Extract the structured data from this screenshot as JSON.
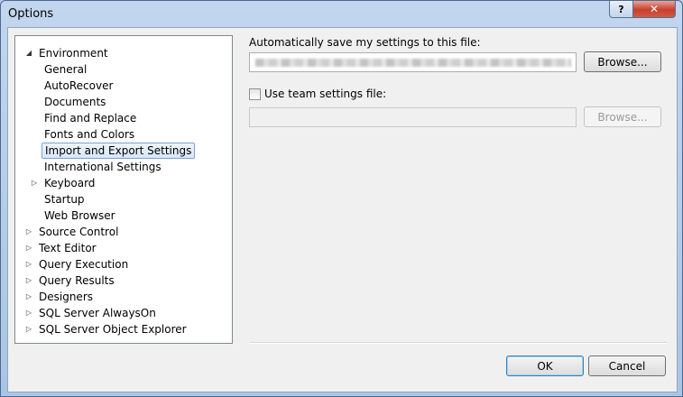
{
  "window": {
    "title": "Options",
    "help_glyph": "?",
    "close_glyph": "✕"
  },
  "tree": {
    "items": [
      {
        "label": "Environment",
        "expander": "◢"
      },
      {
        "label": "General"
      },
      {
        "label": "AutoRecover"
      },
      {
        "label": "Documents"
      },
      {
        "label": "Find and Replace"
      },
      {
        "label": "Fonts and Colors"
      },
      {
        "label": "Import and Export Settings",
        "selected": true
      },
      {
        "label": "International Settings"
      },
      {
        "label": "Keyboard",
        "expander": "▷"
      },
      {
        "label": "Startup"
      },
      {
        "label": "Web Browser"
      },
      {
        "label": "Source Control",
        "expander": "▷"
      },
      {
        "label": "Text Editor",
        "expander": "▷"
      },
      {
        "label": "Query Execution",
        "expander": "▷"
      },
      {
        "label": "Query Results",
        "expander": "▷"
      },
      {
        "label": "Designers",
        "expander": "▷"
      },
      {
        "label": "SQL Server AlwaysOn",
        "expander": "▷"
      },
      {
        "label": "SQL Server Object Explorer",
        "expander": "▷"
      }
    ]
  },
  "settings": {
    "autosave_label": "Automatically save my settings to this file:",
    "browse_label": "Browse...",
    "team_checkbox_label": "Use team settings file:",
    "team_checked": false,
    "team_browse_label": "Browse..."
  },
  "footer": {
    "ok_label": "OK",
    "cancel_label": "Cancel"
  }
}
